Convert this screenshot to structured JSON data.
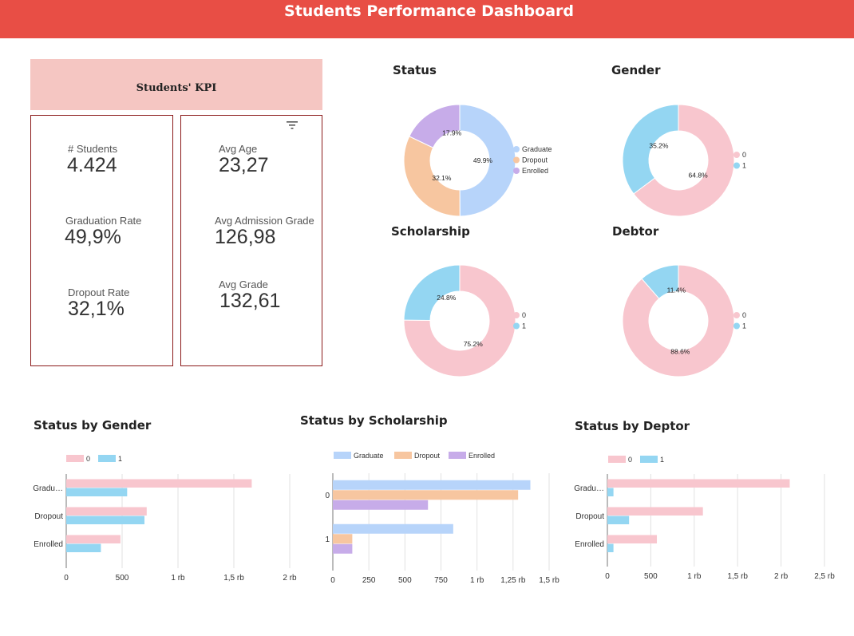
{
  "header": {
    "title": "Students Performance Dashboard"
  },
  "kpi": {
    "title": "Students' KPI",
    "left": [
      {
        "label": "# Students",
        "value": "4.424"
      },
      {
        "label": "Graduation Rate",
        "value": "49,9%"
      },
      {
        "label": "Dropout Rate",
        "value": "32,1%"
      }
    ],
    "right": [
      {
        "label": "Avg Age",
        "value": "23,27"
      },
      {
        "label": "Avg Admission Grade",
        "value": "126,98"
      },
      {
        "label": "Avg Grade",
        "value": "132,61"
      }
    ],
    "filter_icon": "filter-icon"
  },
  "colors": {
    "header": "#e84e45",
    "kpi_title_bg": "#f5c6c2",
    "kpi_border": "#8b1a1a",
    "pink": "#f8c6ce",
    "light_blue": "#94d6f2",
    "blue": "#b7d4fa",
    "orange": "#f7c6a0",
    "purple": "#c7ace9"
  },
  "chart_data": [
    {
      "id": "status",
      "type": "pie",
      "donut": true,
      "title": "Status",
      "series": [
        {
          "name": "Graduate",
          "value": 49.9,
          "label": "49.9%",
          "color": "#b7d4fa"
        },
        {
          "name": "Dropout",
          "value": 32.1,
          "label": "32.1%",
          "color": "#f7c6a0"
        },
        {
          "name": "Enrolled",
          "value": 17.9,
          "label": "17.9%",
          "color": "#c7ace9"
        }
      ]
    },
    {
      "id": "gender",
      "type": "pie",
      "donut": true,
      "title": "Gender",
      "series": [
        {
          "name": "0",
          "value": 64.8,
          "label": "64.8%",
          "color": "#f8c6ce"
        },
        {
          "name": "1",
          "value": 35.2,
          "label": "35.2%",
          "color": "#94d6f2"
        }
      ]
    },
    {
      "id": "scholarship",
      "type": "pie",
      "donut": true,
      "title": "Scholarship",
      "series": [
        {
          "name": "0",
          "value": 75.2,
          "label": "75.2%",
          "color": "#f8c6ce"
        },
        {
          "name": "1",
          "value": 24.8,
          "label": "24.8%",
          "color": "#94d6f2"
        }
      ]
    },
    {
      "id": "debtor",
      "type": "pie",
      "donut": true,
      "title": "Debtor",
      "series": [
        {
          "name": "0",
          "value": 88.6,
          "label": "88.6%",
          "color": "#f8c6ce"
        },
        {
          "name": "1",
          "value": 11.4,
          "label": "11.4%",
          "color": "#94d6f2"
        }
      ]
    },
    {
      "id": "status-by-gender",
      "type": "bar",
      "orientation": "horizontal",
      "title": "Status by Gender",
      "categories": [
        "Gradu…",
        "Dropout",
        "Enrolled"
      ],
      "series": [
        {
          "name": "0",
          "color": "#f8c6ce",
          "values": [
            1660,
            720,
            485
          ]
        },
        {
          "name": "1",
          "color": "#94d6f2",
          "values": [
            545,
            700,
            310
          ]
        }
      ],
      "xlim": [
        0,
        2000
      ],
      "xticks": [
        0,
        500,
        1000,
        1500,
        2000
      ],
      "xtick_labels": [
        "0",
        "500",
        "1 rb",
        "1,5 rb",
        "2 rb"
      ],
      "legend": "top-left",
      "grid": true
    },
    {
      "id": "status-by-scholarship",
      "type": "bar",
      "orientation": "horizontal",
      "title": "Status by Scholarship",
      "categories": [
        "0",
        "1"
      ],
      "series": [
        {
          "name": "Graduate",
          "color": "#b7d4fa",
          "values": [
            1370,
            835
          ]
        },
        {
          "name": "Dropout",
          "color": "#f7c6a0",
          "values": [
            1285,
            135
          ]
        },
        {
          "name": "Enrolled",
          "color": "#c7ace9",
          "values": [
            660,
            135
          ]
        }
      ],
      "xlim": [
        0,
        1500
      ],
      "xticks": [
        0,
        250,
        500,
        750,
        1000,
        1250,
        1500
      ],
      "xtick_labels": [
        "0",
        "250",
        "500",
        "750",
        "1 rb",
        "1,25 rb",
        "1,5 rb"
      ],
      "legend": "top-left",
      "grid": true
    },
    {
      "id": "status-by-debtor",
      "type": "bar",
      "orientation": "horizontal",
      "title": "Status by Deptor",
      "categories": [
        "Gradu…",
        "Dropout",
        "Enrolled"
      ],
      "series": [
        {
          "name": "0",
          "color": "#f8c6ce",
          "values": [
            2100,
            1100,
            570
          ]
        },
        {
          "name": "1",
          "color": "#94d6f2",
          "values": [
            70,
            250,
            70
          ]
        }
      ],
      "xlim": [
        0,
        2500
      ],
      "xticks": [
        0,
        500,
        1000,
        1500,
        2000,
        2500
      ],
      "xtick_labels": [
        "0",
        "500",
        "1 rb",
        "1,5 rb",
        "2 rb",
        "2,5 rb"
      ],
      "legend": "top-left",
      "grid": true
    }
  ]
}
